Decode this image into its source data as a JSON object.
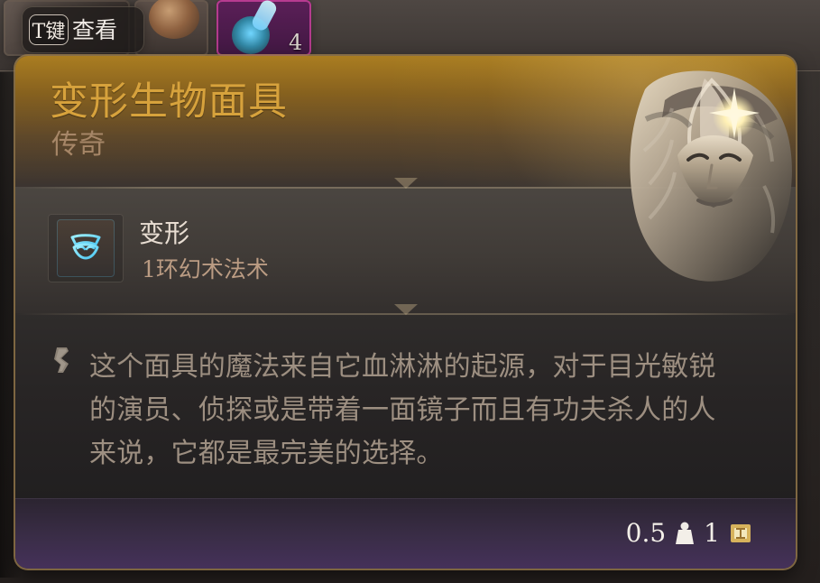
{
  "inventory": {
    "inspect_key": "T键",
    "inspect_label": "查看",
    "stack_count": "4"
  },
  "tooltip": {
    "title": "变形生物面具",
    "rarity": "传奇",
    "spell": {
      "name": "变形",
      "level": "1环幻术法术",
      "icon": "mask-spell-icon"
    },
    "description": "这个面具的魔法来自它血淋淋的起源，对于目光敏锐\n的演员、侦探或是带着一面镜子而且有功夫杀人的人\n来说，它都是最完美的选择。",
    "footer": {
      "weight_value": "0.5",
      "weight_icon": "weight-icon",
      "gold_value": "1",
      "gold_icon": "gold-icon"
    }
  },
  "colors": {
    "title": "#d7a23c",
    "rarity": "#a68667",
    "spell_name": "#e8ddd2",
    "spell_level": "#bb9c83",
    "description": "#9d8f81",
    "footer_text": "#f3efe8",
    "accent_gold": "#c89a3a",
    "rarity_purple": "#45315a",
    "spell_icon_cyan": "#6dd6ff"
  }
}
